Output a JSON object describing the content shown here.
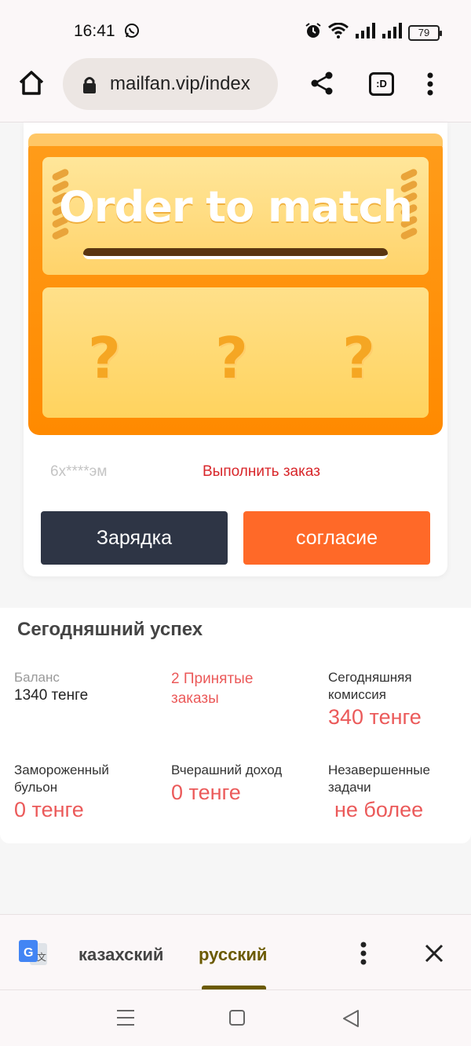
{
  "status_bar": {
    "time": "16:41",
    "battery": "79",
    "icons": [
      "whatsapp-icon",
      "alarm-icon",
      "wifi-icon",
      "signal-icon",
      "signal-icon",
      "battery-icon"
    ]
  },
  "browser": {
    "url": "mailfan.vip/index"
  },
  "match_card": {
    "banner_text": "Order to match",
    "placeholders": [
      "?",
      "?",
      "?"
    ],
    "masked_user": "6х****эм",
    "fulfill_link": "Выполнить заказ",
    "charge_label": "Зарядка",
    "agree_label": "согласие",
    "colors": {
      "machine": "#ff8a00",
      "charge_button": "#2e3545",
      "agree_button": "#ff6928"
    }
  },
  "stats": {
    "title": "Сегодняшний успех",
    "balance_label": "Баланс",
    "balance_value": "1340 тенге",
    "accepted_orders": "2 Принятые заказы",
    "commission_label": "Сегодняшняя комиссия",
    "commission_value": "340 тенге",
    "frozen_label": "Замороженный бульон",
    "frozen_value": "0 тенге",
    "yesterday_label": "Вчерашний доход",
    "yesterday_value": "0 тенге",
    "unfinished_label": "Незавершенные задачи",
    "unfinished_value": "не более",
    "accent_color": "#eb5a5a"
  },
  "translate_bar": {
    "lang_source": "казахский",
    "lang_target": "русский"
  }
}
